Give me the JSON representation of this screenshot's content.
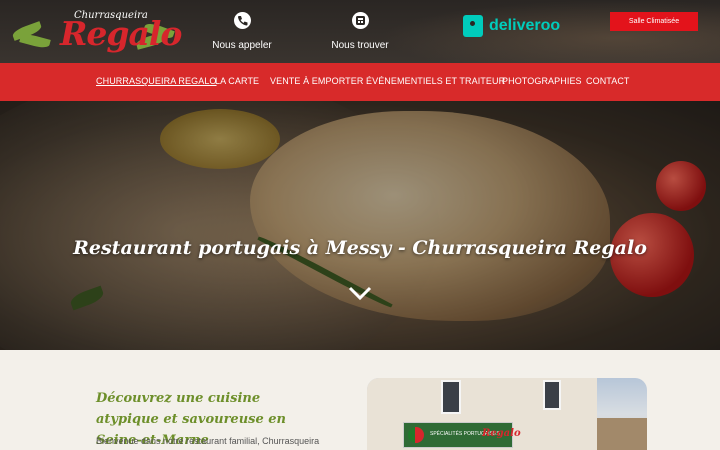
{
  "brand": {
    "small": "Churrasqueira",
    "big": "Regalo"
  },
  "header": {
    "call_label": "Nous appeler",
    "find_label": "Nous trouver",
    "deliveroo_label": "deliveroo",
    "salle_label": "Salle Climatisée"
  },
  "nav": {
    "items": [
      "CHURRASQUEIRA REGALO",
      "LA CARTE",
      "VENTE À EMPORTER",
      "ÉVÉNEMENTIELS ET TRAITEUR",
      "PHOTOGRAPHIES",
      "CONTACT"
    ]
  },
  "hero": {
    "title": "Restaurant portugais à Messy - Churrasqueira Regalo"
  },
  "intro": {
    "title": "Découvrez une cuisine atypique et savoureuse en Seine-et-Marne",
    "text": "Bienvenue dans notre restaurant familial, Churrasqueira Regalo. Nous vous accueillons dans un cadre chaleureux"
  },
  "photo": {
    "sign_text": "SPÉCIALITÉS PORTUGAISES",
    "sign_logo": "Regalo"
  },
  "colors": {
    "nav": "#d82a2a",
    "salle_button": "#e3131b",
    "brand_red": "#d7262c",
    "deliveroo": "#00ccbc",
    "heading_green": "#6d8f2a"
  },
  "icons": [
    "phone-icon",
    "map-icon",
    "deliveroo-logo-icon",
    "chevron-down-icon"
  ]
}
